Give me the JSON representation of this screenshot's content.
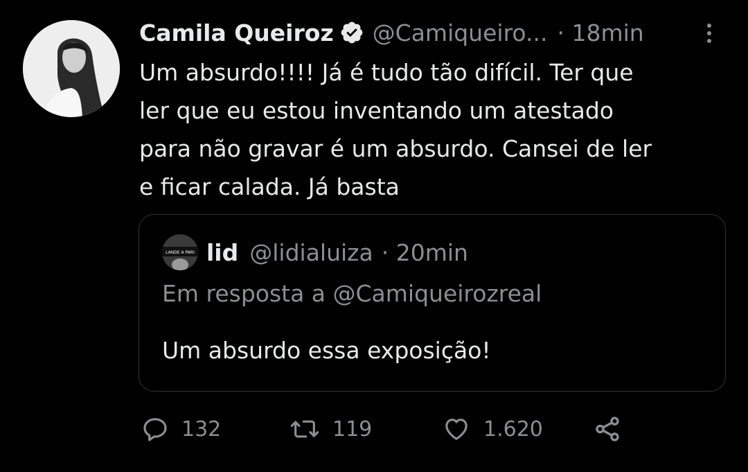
{
  "tweet": {
    "author": {
      "display_name": "Camila Queiroz",
      "handle": "@Camiqueiro...",
      "verified_icon": "verified-badge-icon",
      "avatar_icon": "profile-photo"
    },
    "time": "· 18min",
    "more_icon": "more-vertical-icon",
    "text": "Um absurdo!!!! Já é tudo tão difícil. Ter que\nler que eu estou inventando um atestado\npara não gravar é um absurdo. Cansei de ler\ne ficar calada. Já basta"
  },
  "quoted_tweet": {
    "author": {
      "display_name": "lid",
      "handle": "@lidialuiza",
      "avatar_icon": "profile-photo"
    },
    "time": "· 20min",
    "reply_to": "Em resposta a @Camiqueirozreal",
    "text": "Um absurdo essa exposição!"
  },
  "actions": {
    "reply": {
      "icon": "reply-icon",
      "count": "132"
    },
    "retweet": {
      "icon": "retweet-icon",
      "count": "119"
    },
    "like": {
      "icon": "heart-icon",
      "count": "1.620"
    },
    "share": {
      "icon": "share-icon"
    }
  },
  "colors": {
    "background": "#000000",
    "text_primary": "#e7e9ea",
    "text_secondary": "#8b8f93",
    "border": "#2f3336"
  }
}
